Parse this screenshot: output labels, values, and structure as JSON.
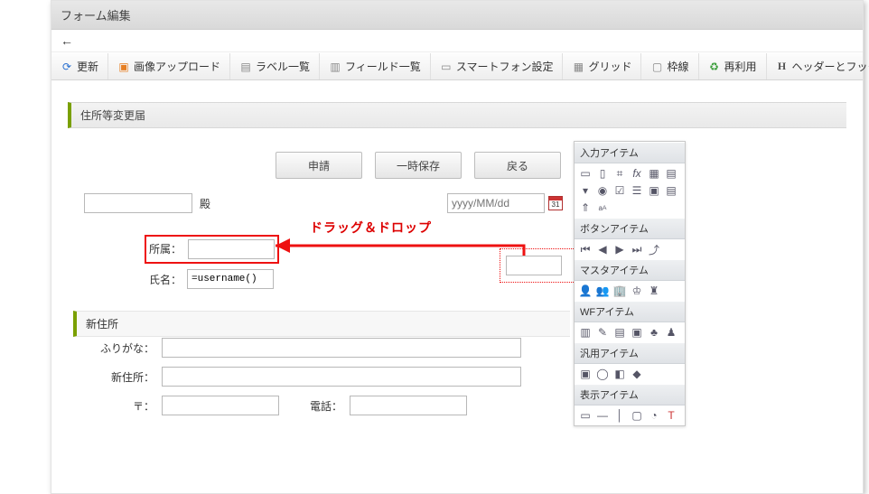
{
  "window": {
    "title": "フォーム編集"
  },
  "toolbar": {
    "items": [
      {
        "label": "更新",
        "icon": "refresh-icon"
      },
      {
        "label": "画像アップロード",
        "icon": "image-upload-icon"
      },
      {
        "label": "ラベル一覧",
        "icon": "label-list-icon"
      },
      {
        "label": "フィールド一覧",
        "icon": "field-list-icon"
      },
      {
        "label": "スマートフォン設定",
        "icon": "smartphone-icon"
      },
      {
        "label": "グリッド",
        "icon": "grid-icon"
      },
      {
        "label": "枠線",
        "icon": "border-icon"
      },
      {
        "label": "再利用",
        "icon": "reuse-icon"
      },
      {
        "label": "ヘッダーとフッター",
        "icon": "header-footer-icon"
      }
    ]
  },
  "form": {
    "title": "住所等変更届",
    "buttons": {
      "apply": "申請",
      "save": "一時保存",
      "back": "戻る"
    },
    "recipient_suffix": "殿",
    "date_placeholder": "yyyy/MM/dd",
    "labels": {
      "affiliation": "所属：",
      "name": "氏名：",
      "new_address_section": "新住所",
      "furigana": "ふりがな：",
      "new_address": "新住所：",
      "zip": "〒：",
      "tel": "電話："
    },
    "name_value": "=username()"
  },
  "annotation": {
    "drag_drop_text": "ドラッグ＆ドロップ"
  },
  "palette": {
    "sections": {
      "input": "入力アイテム",
      "button": "ボタンアイテム",
      "master": "マスタアイテム",
      "wf": "WFアイテム",
      "generic": "汎用アイテム",
      "display": "表示アイテム"
    }
  }
}
